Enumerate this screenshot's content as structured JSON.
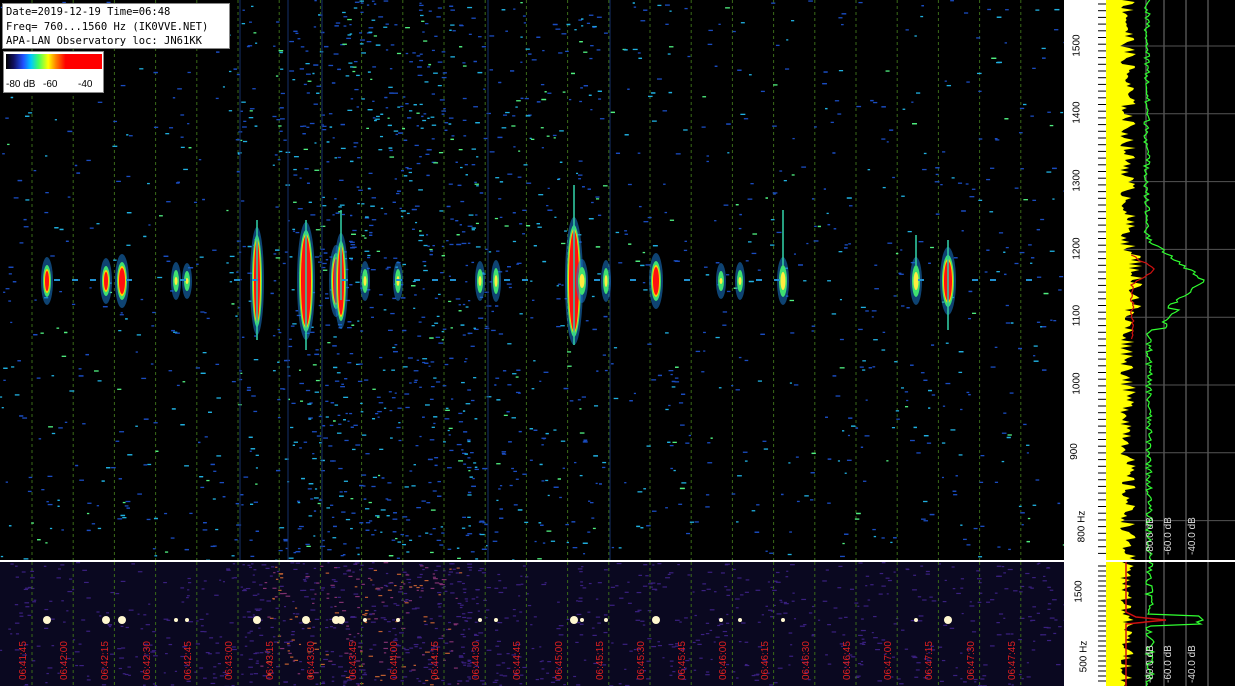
{
  "info": {
    "line1": "Date=2019-12-19 Time=06:48",
    "line2": "Freq= 760...1560 Hz (IK0VVE.NET)",
    "line3": "APA-LAN Observatory loc: JN61KK"
  },
  "colorbar": {
    "label_a": "-80 dB",
    "label_b": "-60",
    "label_c": "-40"
  },
  "time_axis": [
    "06:41:45",
    "06:42:00",
    "06:42:15",
    "06:42:30",
    "06:42:45",
    "06:43:00",
    "06:43:15",
    "06:43:30",
    "06:43:45",
    "06:44:00",
    "06:44:15",
    "06:44:30",
    "06:44:45",
    "06:45:00",
    "06:45:15",
    "06:45:30",
    "06:45:45",
    "06:46:00",
    "06:46:15",
    "06:46:30",
    "06:46:45",
    "06:47:00",
    "06:47:15",
    "06:47:30",
    "06:47:45"
  ],
  "freq_axis_main": [
    "1500",
    "1400",
    "1300",
    "1200",
    "1100",
    "1000",
    "900",
    "800 Hz"
  ],
  "freq_axis_lower": [
    "1500",
    "500 Hz"
  ],
  "spectrum_db_main": [
    "-80.0 dB",
    "-60.0 dB",
    "-40.0 dB"
  ],
  "spectrum_db_lower": [
    "-80.0 dB",
    "-60.0 dB",
    "-40.0 dB"
  ],
  "colors": {
    "grid": "#3a6a18",
    "time_label": "#e02020",
    "signal_core": "#ff1010",
    "spectrum_avg": "#30ff30",
    "spectrum_peak": "#ffff00",
    "spectrum_min": "#d01010"
  }
}
